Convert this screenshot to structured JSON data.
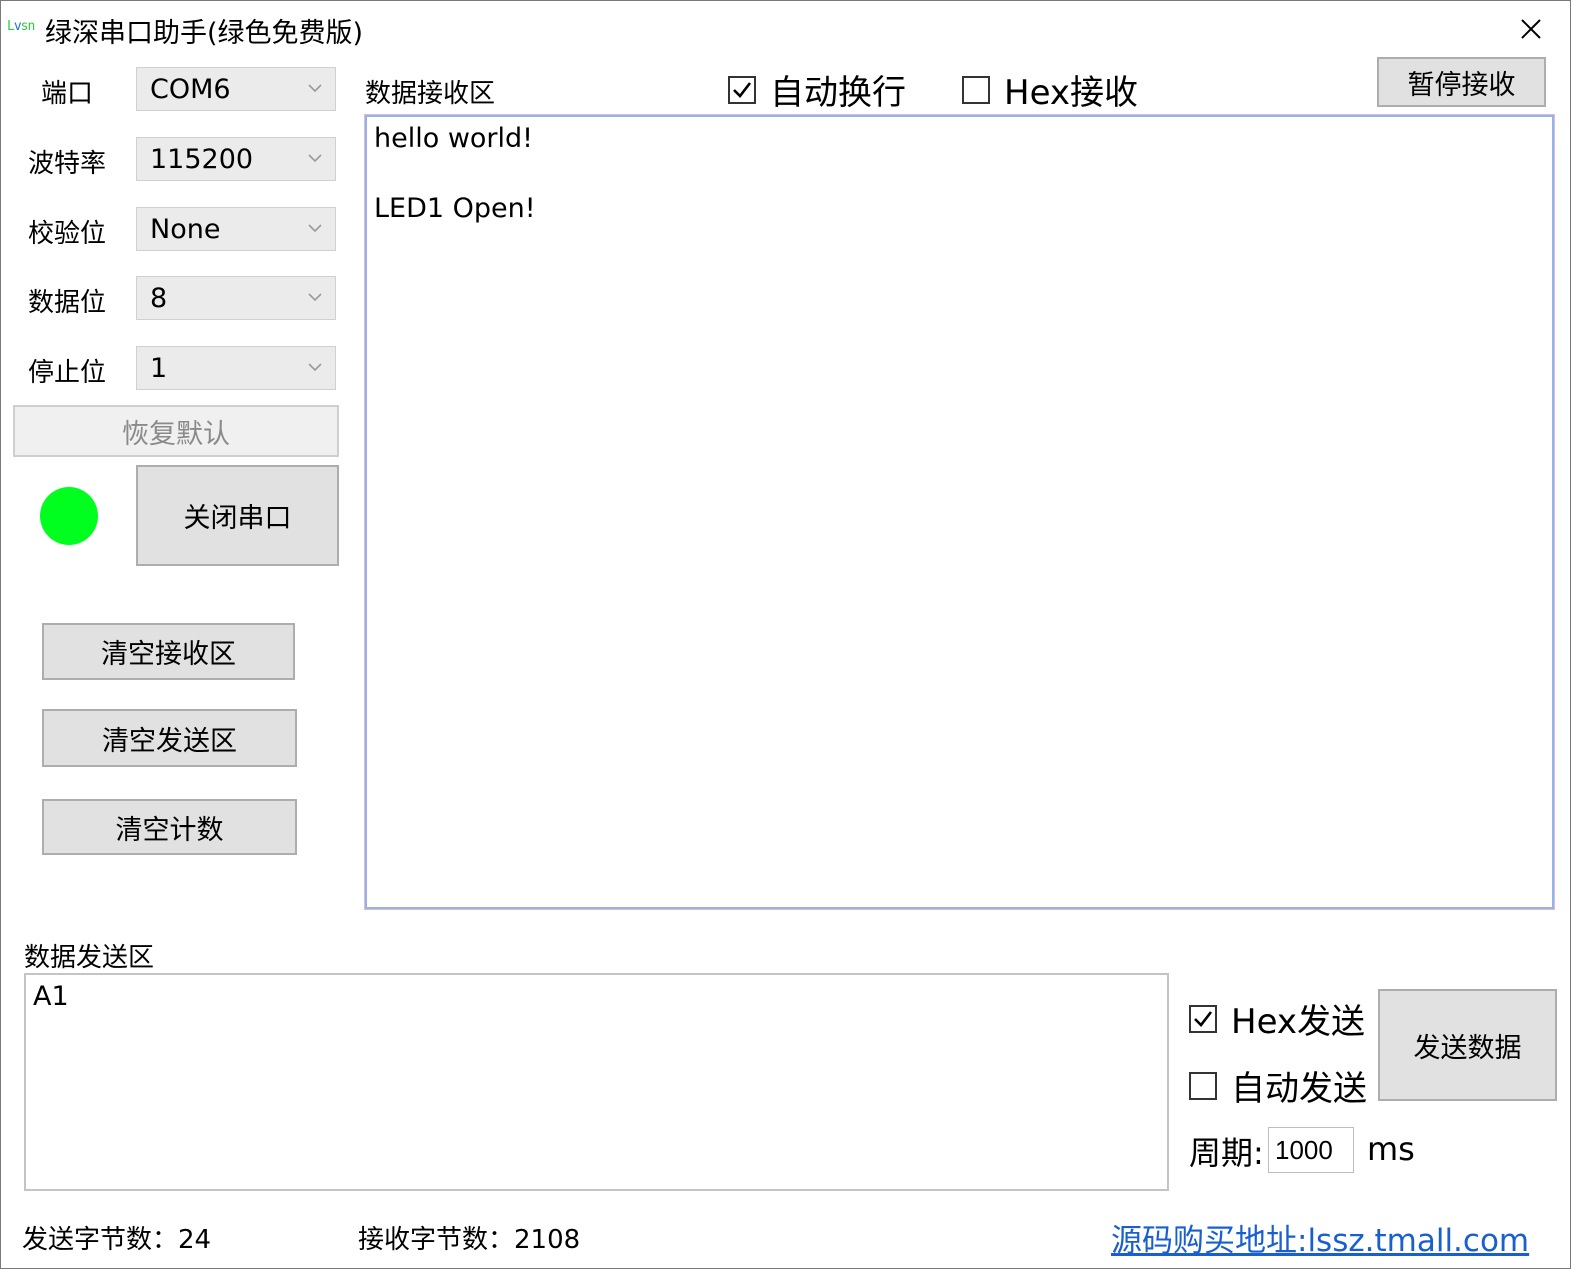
{
  "window": {
    "logo_text": "Lvsn",
    "title": "绿深串口助手(绿色免费版)"
  },
  "settings": {
    "port_label": "端口",
    "port_value": "COM6",
    "baud_label": "波特率",
    "baud_value": "115200",
    "parity_label": "校验位",
    "parity_value": "None",
    "databits_label": "数据位",
    "databits_value": "8",
    "stopbits_label": "停止位",
    "stopbits_value": "1",
    "restore_default_label": "恢复默认",
    "close_port_label": "关闭串口",
    "indicator_color": "#00ff1e"
  },
  "actions": {
    "clear_recv_label": "清空接收区",
    "clear_send_label": "清空发送区",
    "clear_count_label": "清空计数"
  },
  "receive": {
    "title": "数据接收区",
    "auto_wrap_label": "自动换行",
    "auto_wrap_checked": true,
    "hex_recv_label": "Hex接收",
    "hex_recv_checked": false,
    "pause_label": "暂停接收",
    "content": "hello world!\n\nLED1 Open!"
  },
  "send": {
    "title": "数据发送区",
    "content": "A1",
    "hex_send_label": "Hex发送",
    "hex_send_checked": true,
    "auto_send_label": "自动发送",
    "auto_send_checked": false,
    "send_button_label": "发送数据",
    "period_label": "周期:",
    "period_value": "1000",
    "period_unit": "ms"
  },
  "status": {
    "sent_bytes_text": "发送字节数：24",
    "recv_bytes_text": "接收字节数：2108",
    "link_text": "源码购买地址:lssz.tmall.com"
  }
}
